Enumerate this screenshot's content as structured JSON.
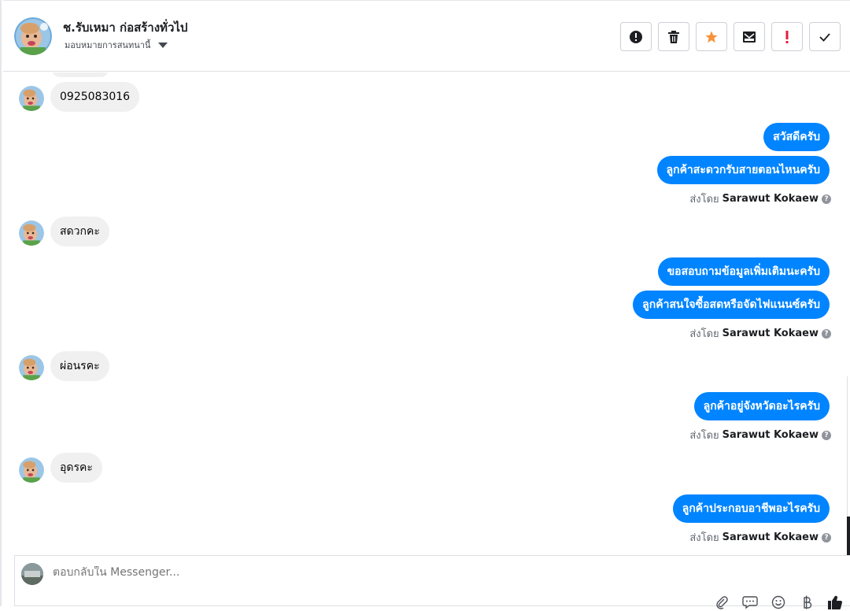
{
  "header": {
    "contact_name": "ช.รับเหมา ก่อสร้างทั่วไป",
    "assign_label": "มอบหมายการสนทนานี้",
    "actions": [
      {
        "name": "spam-button",
        "icon": "alert-circle-icon"
      },
      {
        "name": "delete-button",
        "icon": "trash-icon"
      },
      {
        "name": "star-button",
        "icon": "star-icon"
      },
      {
        "name": "mark-unread-button",
        "icon": "envelope-icon"
      },
      {
        "name": "follow-up-button",
        "icon": "exclamation-icon"
      },
      {
        "name": "mark-done-button",
        "icon": "check-icon"
      }
    ],
    "accent_star": "#f7923b",
    "accent_alert": "#e41e3f"
  },
  "messages": {
    "in_1": "0925083016",
    "out_1a": "สวัสดีครับ",
    "out_1b": "ลูกค้าสะดวกรับสายตอนไหนครับ",
    "in_2": "สดวกคะ",
    "out_2a": "ขอสอบถามข้อมูลเพิ่มเติมนะครับ",
    "out_2b": "ลูกค้าสนใจซื้อสดหรือจัดไฟแนนซ์ครับ",
    "in_3": "ผ่อนรคะ",
    "out_3": "ลูกค้าอยู่จังหวัดอะไรครับ",
    "in_4": "อุดรคะ",
    "out_4": "ลูกค้าประกอบอาชีพอะไรครับ"
  },
  "sent_by": {
    "prefix": "ส่งโดย",
    "agent": "Sarawut Kokaew",
    "help": "?"
  },
  "composer": {
    "placeholder": "ตอบกลับใน Messenger..."
  },
  "colors": {
    "outgoing_bubble": "#0084ff",
    "incoming_bubble": "#f0f0f0"
  }
}
